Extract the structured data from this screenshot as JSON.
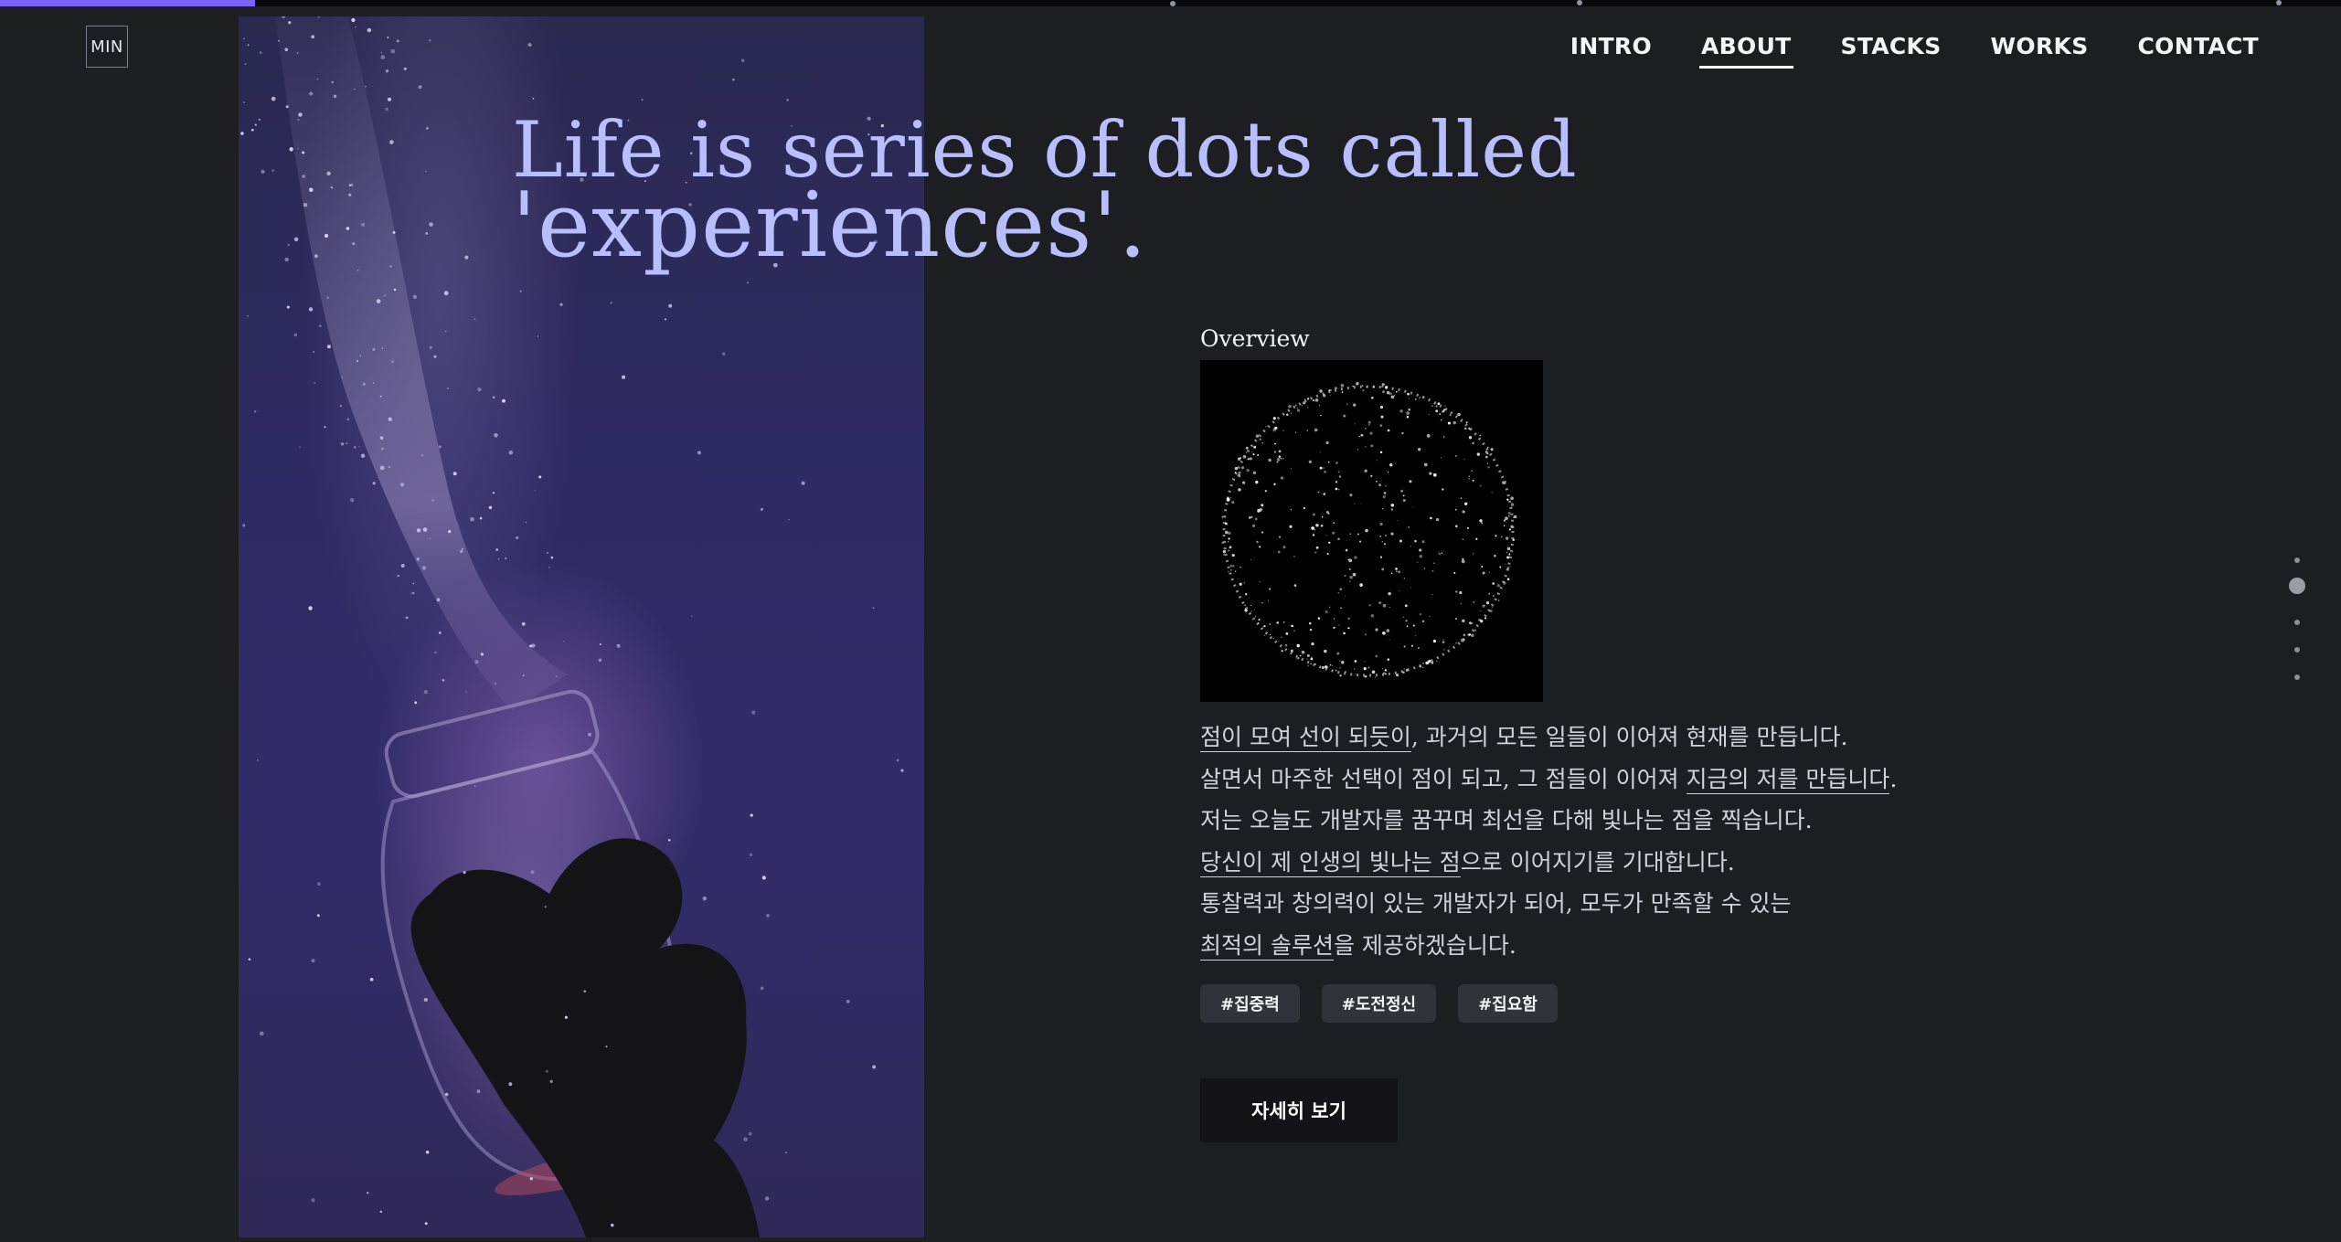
{
  "progress": {
    "fraction": 0.109,
    "color": "#7b61ff"
  },
  "logo": {
    "text": "MIN"
  },
  "nav": {
    "items": [
      {
        "label": "INTRO",
        "active": false
      },
      {
        "label": "ABOUT",
        "active": true
      },
      {
        "label": "STACKS",
        "active": false
      },
      {
        "label": "WORKS",
        "active": false
      },
      {
        "label": "CONTACT",
        "active": false
      }
    ]
  },
  "hero": {
    "line1": "Life is series of dots called",
    "line2": "'experiences'.",
    "image_icon": "star-jar-photo"
  },
  "overview": {
    "label": "Overview",
    "image_icon": "dotted-globe-image",
    "lines": [
      {
        "u": "점이 모여 선이 되듯이",
        "rest": ", 과거의 모든 일들이 이어져 현재를 만듭니다."
      },
      {
        "pre": "살면서 마주한 선택이 점이 되고, 그 점들이 이어져 ",
        "u": "지금의 저를 만듭니다",
        "rest": "."
      },
      {
        "pre": "저는 오늘도 개발자를 꿈꾸며 최선을 다해 빛나는 점을 찍습니다."
      },
      {
        "u": "당신이 제 인생의 빛나는 점",
        "rest": "으로 이어지기를 기대합니다."
      },
      {
        "pre": "통찰력과 창의력이 있는 개발자가 되어, 모두가 만족할 수 있는"
      },
      {
        "u": "최적의 솔루션",
        "rest": "을 제공하겠습니다."
      }
    ],
    "tags": [
      "#집중력",
      "#도전정신",
      "#집요함"
    ],
    "more_button": "자세히 보기"
  },
  "side_nav": {
    "count": 5,
    "active_index": 1
  },
  "colors": {
    "background": "#1d1e22",
    "headline": "#b9beff",
    "accent": "#7b61ff",
    "tag_bg": "#31323a",
    "button_bg": "#131317"
  }
}
